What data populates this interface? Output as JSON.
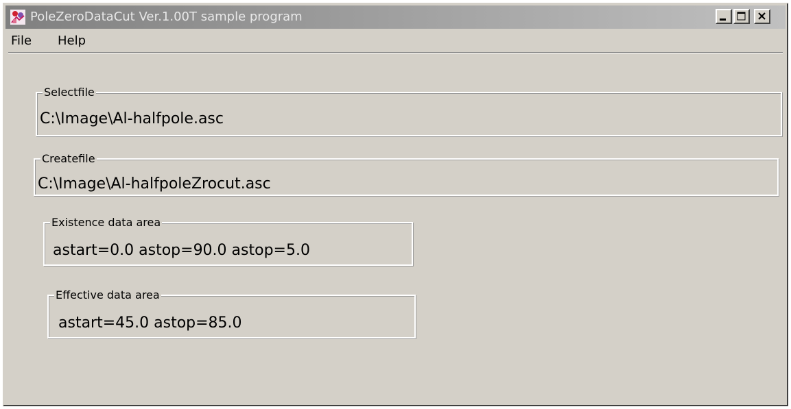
{
  "window": {
    "title": "PoleZeroDataCut Ver.1.00T sample program",
    "controls": [
      "minimize",
      "maximize",
      "close"
    ]
  },
  "menu": {
    "file_label": "File",
    "help_label": "Help"
  },
  "groups": {
    "select_file": {
      "label": "Selectfile",
      "value": "C:\\Image\\Al-halfpole.asc"
    },
    "create_file": {
      "label": "Createfile",
      "value": "C:\\Image\\Al-halfpoleZrocut.asc"
    },
    "existence_area": {
      "label": "Existence data area",
      "value": "astart=0.0 astop=90.0 astop=5.0"
    },
    "effective_area": {
      "label": "Effective data area",
      "value": "astart=45.0 astop=85.0"
    }
  },
  "icons": {
    "app": "app-icon",
    "minimize": "minimize-icon",
    "maximize": "maximize-icon",
    "close": "close-icon"
  },
  "colors": {
    "face": "#d4d0c8",
    "titlebar_start": "#808080",
    "titlebar_end": "#c0c0c0",
    "title_text": "#e8e8e8"
  }
}
